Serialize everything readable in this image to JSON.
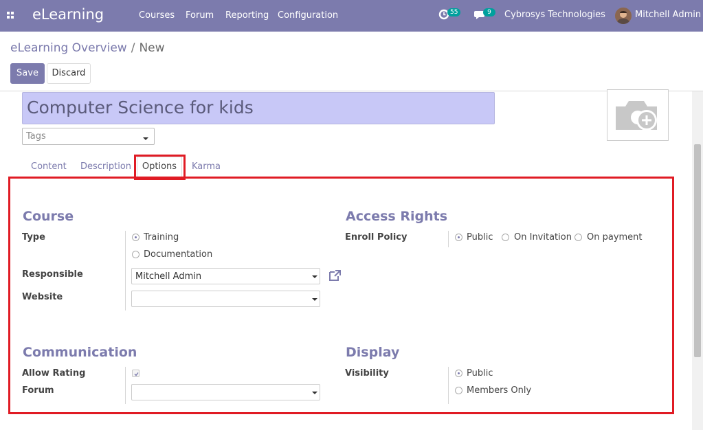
{
  "navbar": {
    "app_name": "eLearning",
    "menu": [
      "Courses",
      "Forum",
      "Reporting",
      "Configuration"
    ],
    "activity_count": "55",
    "message_count": "9",
    "company": "Cybrosys Technologies",
    "user": "Mitchell Admin"
  },
  "breadcrumb": {
    "parent": "eLearning Overview",
    "separator": "/",
    "current": "New"
  },
  "buttons": {
    "save": "Save",
    "discard": "Discard"
  },
  "form": {
    "title": "Computer Science for kids",
    "tags_placeholder": "Tags",
    "tabs": [
      "Content",
      "Description",
      "Options",
      "Karma"
    ],
    "active_tab": "Options",
    "course": {
      "heading": "Course",
      "type_label": "Type",
      "type_options": [
        "Training",
        "Documentation"
      ],
      "type_selected": "Training",
      "responsible_label": "Responsible",
      "responsible_value": "Mitchell Admin",
      "website_label": "Website",
      "website_value": ""
    },
    "access_rights": {
      "heading": "Access Rights",
      "enroll_label": "Enroll Policy",
      "enroll_options": [
        "Public",
        "On Invitation",
        "On payment"
      ],
      "enroll_selected": "Public"
    },
    "communication": {
      "heading": "Communication",
      "allow_rating_label": "Allow Rating",
      "allow_rating_checked": true,
      "forum_label": "Forum",
      "forum_value": ""
    },
    "display": {
      "heading": "Display",
      "visibility_label": "Visibility",
      "visibility_options": [
        "Public",
        "Members Only"
      ],
      "visibility_selected": "Public"
    }
  },
  "colors": {
    "brand": "#7c7bad",
    "highlight": "#e01b24",
    "badge": "#00a09d"
  }
}
